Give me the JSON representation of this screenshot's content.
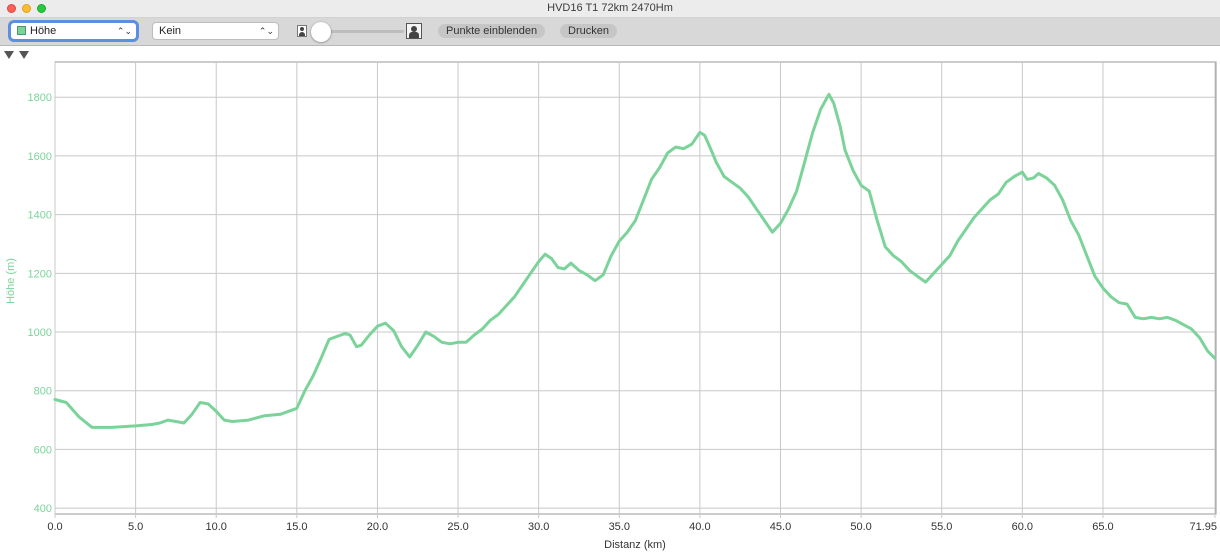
{
  "window": {
    "title": "HVD16 T1 72km 2470Hm"
  },
  "toolbar": {
    "primary_select": "Höhe",
    "primary_swatch_color": "#7bd39a",
    "secondary_select": "Kein",
    "slider_value": 0,
    "show_points_label": "Punkte einblenden",
    "print_label": "Drucken"
  },
  "chart_data": {
    "type": "line",
    "xlabel": "Distanz (km)",
    "ylabel": "Höhe (m)",
    "xlim": [
      0,
      71.95
    ],
    "ylim": [
      380,
      1920
    ],
    "xticks": [
      "0.0",
      "5.0",
      "10.0",
      "15.0",
      "20.0",
      "25.0",
      "30.0",
      "35.0",
      "40.0",
      "45.0",
      "50.0",
      "55.0",
      "60.0",
      "65.0",
      "71.95"
    ],
    "xtick_values": [
      0,
      5,
      10,
      15,
      20,
      25,
      30,
      35,
      40,
      45,
      50,
      55,
      60,
      65,
      71.95
    ],
    "yticks": [
      400,
      600,
      800,
      1000,
      1200,
      1400,
      1600,
      1800
    ],
    "line_color": "#7bd39a",
    "label_color": "#7bd39a",
    "series": [
      {
        "x": [
          0,
          0.7,
          1.5,
          2.3,
          3.5,
          5,
          6,
          6.5,
          7,
          7.5,
          8,
          8.5,
          9,
          9.5,
          10,
          10.5,
          11,
          12,
          13,
          14,
          15,
          15.5,
          16,
          16.5,
          17,
          17.5,
          18,
          18.3,
          18.7,
          19,
          19.5,
          20,
          20.5,
          21,
          21.5,
          22,
          22.5,
          23,
          23.5,
          24,
          24.5,
          25,
          25.5,
          26,
          26.5,
          27,
          27.5,
          28,
          28.5,
          29,
          29.5,
          30,
          30.4,
          30.8,
          31.2,
          31.6,
          32,
          32.5,
          33,
          33.5,
          34,
          34.5,
          35,
          35.5,
          36,
          36.5,
          37,
          37.5,
          38,
          38.5,
          39,
          39.5,
          40,
          40.3,
          40.7,
          41,
          41.5,
          42,
          42.5,
          43,
          43.5,
          44,
          44.5,
          45,
          45.5,
          46,
          46.5,
          47,
          47.5,
          48,
          48.3,
          48.7,
          49,
          49.5,
          50,
          50.5,
          51,
          51.5,
          52,
          52.5,
          53,
          53.5,
          54,
          54.5,
          55,
          55.5,
          56,
          56.5,
          57,
          57.5,
          58,
          58.5,
          59,
          59.5,
          60,
          60.3,
          60.7,
          61,
          61.5,
          62,
          62.5,
          63,
          63.5,
          64,
          64.5,
          65,
          65.5,
          66,
          66.5,
          67,
          67.5,
          68,
          68.5,
          69,
          69.5,
          70,
          70.5,
          71,
          71.5,
          71.95
        ],
        "y": [
          770,
          760,
          710,
          675,
          675,
          680,
          685,
          690,
          700,
          695,
          690,
          720,
          760,
          755,
          730,
          700,
          695,
          700,
          715,
          720,
          740,
          800,
          850,
          910,
          975,
          985,
          995,
          990,
          950,
          955,
          990,
          1020,
          1030,
          1005,
          950,
          915,
          955,
          1000,
          985,
          965,
          960,
          965,
          965,
          990,
          1010,
          1040,
          1060,
          1090,
          1120,
          1160,
          1200,
          1240,
          1265,
          1250,
          1220,
          1215,
          1235,
          1210,
          1195,
          1175,
          1195,
          1260,
          1310,
          1340,
          1380,
          1450,
          1520,
          1560,
          1610,
          1630,
          1625,
          1640,
          1680,
          1670,
          1620,
          1580,
          1530,
          1510,
          1490,
          1460,
          1420,
          1380,
          1340,
          1370,
          1420,
          1480,
          1580,
          1680,
          1760,
          1810,
          1780,
          1700,
          1620,
          1550,
          1500,
          1480,
          1380,
          1290,
          1260,
          1240,
          1210,
          1190,
          1170,
          1200,
          1230,
          1260,
          1310,
          1350,
          1390,
          1420,
          1450,
          1470,
          1510,
          1530,
          1545,
          1520,
          1525,
          1540,
          1525,
          1500,
          1450,
          1380,
          1330,
          1260,
          1190,
          1150,
          1120,
          1100,
          1095,
          1050,
          1045,
          1050,
          1045,
          1050,
          1040,
          1025,
          1010,
          980,
          935,
          910
        ]
      }
    ]
  }
}
